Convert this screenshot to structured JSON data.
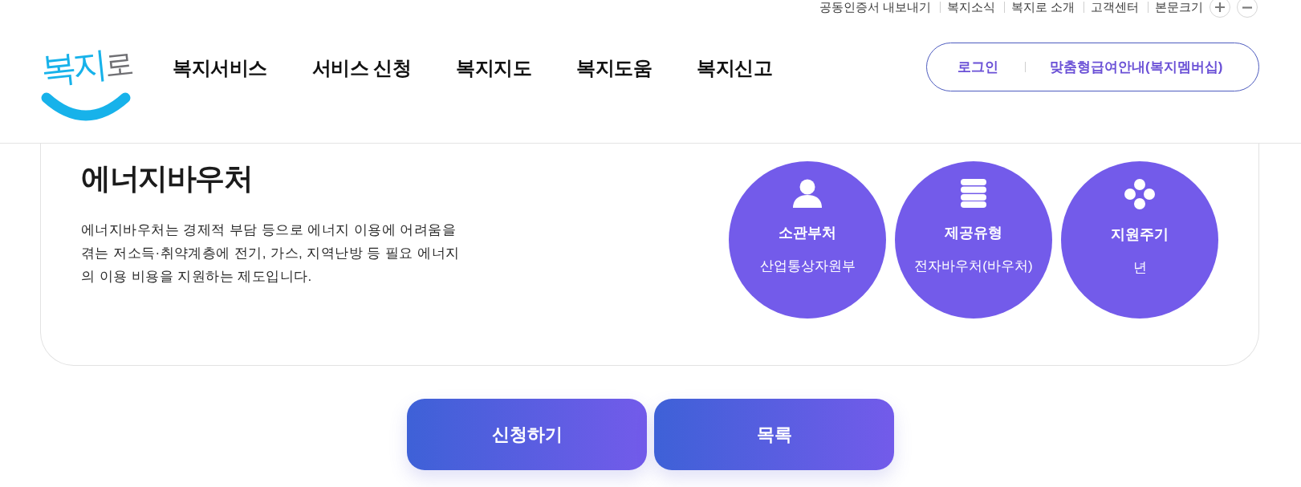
{
  "utility_bar": {
    "links": [
      "공동인증서 내보내기",
      "복지소식",
      "복지로 소개",
      "고객센터"
    ],
    "font_size_label": "본문크기"
  },
  "header": {
    "logo": "복지로",
    "nav": [
      "복지서비스",
      "서비스 신청",
      "복지지도",
      "복지도움",
      "복지신고"
    ],
    "account": {
      "login": "로그인",
      "membership": "맞춤형급여안내(복지멤버십)"
    }
  },
  "program": {
    "title": "에너지바우처",
    "description": "에너지바우처는 경제적 부담 등으로 에너지 이용에 어려움을 겪는 저소득·취약계층에 전기, 가스, 지역난방 등 필요 에너지의 이용 비용을 지원하는 제도입니다.",
    "facts": [
      {
        "label": "소관부처",
        "value": "산업통상자원부"
      },
      {
        "label": "제공유형",
        "value": "전자바우처(바우처)"
      },
      {
        "label": "지원주기",
        "value": "년"
      }
    ]
  },
  "actions": [
    "신청하기",
    "목록"
  ]
}
